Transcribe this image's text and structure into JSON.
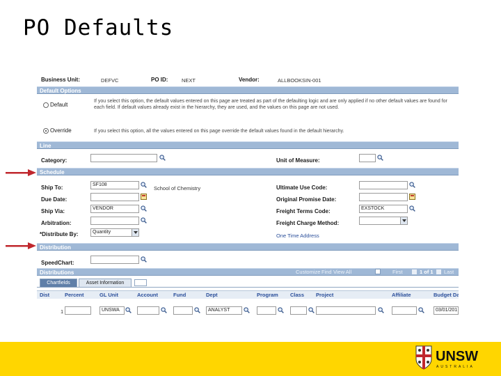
{
  "slide": {
    "title": "PO Defaults"
  },
  "header": {
    "business_unit_label": "Business Unit:",
    "business_unit_value": "DEFVC",
    "po_id_label": "PO ID:",
    "po_id_value": "NEXT",
    "vendor_label": "Vendor:",
    "vendor_value": "ALLBOOKSIN-001"
  },
  "sections": {
    "default_options": "Default Options",
    "line": "Line",
    "schedule": "Schedule",
    "distribution": "Distribution",
    "distributions": "Distributions"
  },
  "default_options": {
    "default_label": "Default",
    "default_text": "If you select this option, the default values entered on this page are treated as part of the defaulting logic and are only applied if no other default values are found for each field. If default values already exist in the hierarchy, they are used, and the values on this page are not used.",
    "override_label": "Override",
    "override_text": "If you select this option, all the values entered on this page override the default values found in the default hierarchy."
  },
  "line": {
    "category_label": "Category:",
    "uom_label": "Unit of Measure:"
  },
  "schedule": {
    "ship_to_label": "Ship To:",
    "ship_to_value": "SF108",
    "ship_to_desc": "School of Chemistry",
    "due_date_label": "Due Date:",
    "ship_via_label": "Ship Via:",
    "ship_via_value": "VENDOR",
    "arbitration_label": "Arbitration:",
    "distribute_by_label": "*Distribute By:",
    "distribute_by_value": "Quantity",
    "ultimate_use_label": "Ultimate Use Code:",
    "orig_promise_label": "Original Promise Date:",
    "freight_terms_label": "Freight Terms Code:",
    "freight_terms_value": "EXSTOCK",
    "freight_charge_label": "Freight Charge Method:",
    "one_time_address": "One Time Address"
  },
  "distribution": {
    "speedchart_label": "SpeedChart:",
    "grid_links": {
      "customize": "Customize",
      "find": "Find",
      "view_all": "View All",
      "first": "First",
      "count": "1 of 1",
      "last": "Last"
    },
    "tabs": [
      "Chartfields",
      "Asset Information"
    ],
    "columns": [
      "Dist",
      "Percent",
      "GL Unit",
      "Account",
      "Fund",
      "Dept",
      "Program",
      "Class",
      "Project",
      "Affiliate",
      "Budget Da"
    ],
    "row": {
      "dist": "1",
      "gl_unit": "UNSWA",
      "dept": "ANALYST",
      "budget_date": "03/01/201"
    }
  },
  "branding": {
    "logo_text": "UNSW",
    "logo_sub": "AUSTRALIA"
  },
  "colors": {
    "section_bar": "#9fb8d6",
    "footer": "#ffd600",
    "arrow": "#c0272d",
    "link": "#2a4e9a"
  }
}
